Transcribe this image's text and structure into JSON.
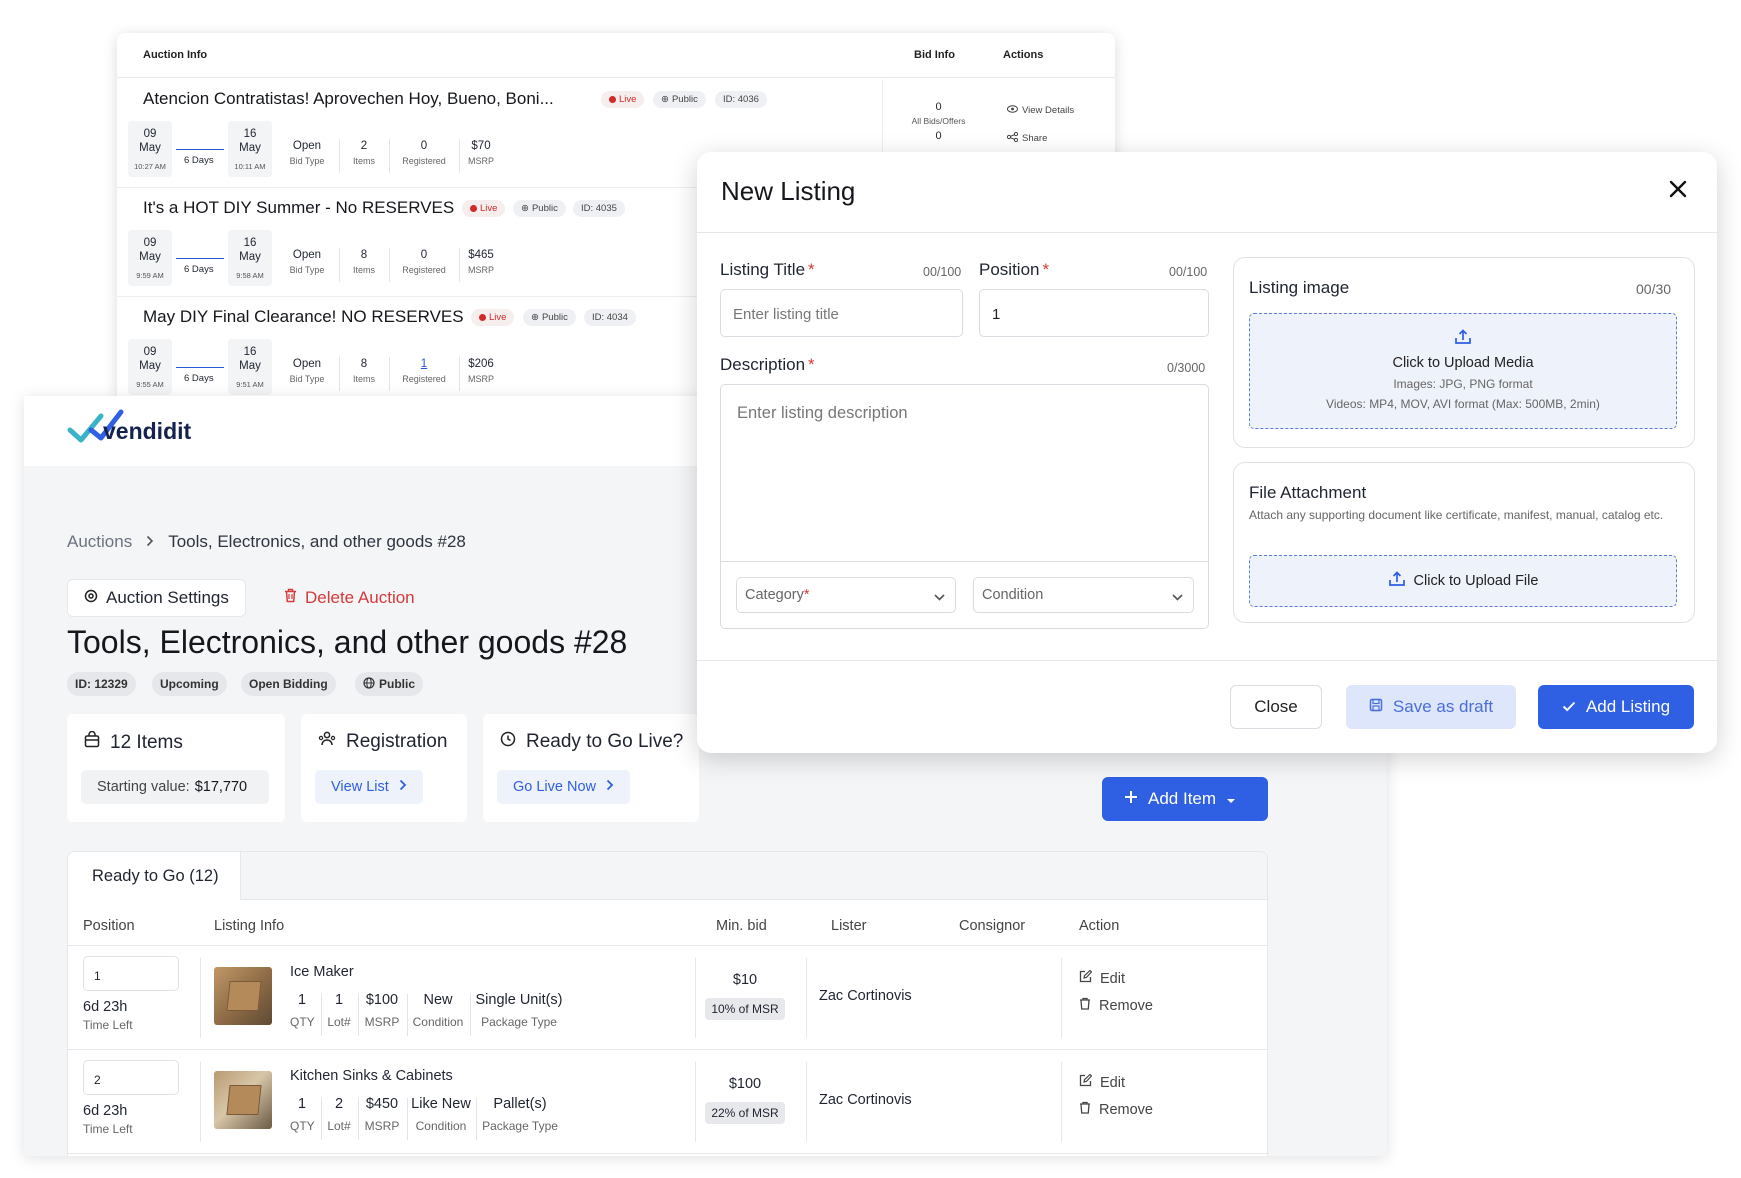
{
  "back_table": {
    "headers": {
      "auction_info": "Auction Info",
      "bid_info": "Bid Info",
      "actions": "Actions"
    },
    "rows": [
      {
        "title": "Atencion Contratistas! Aprovechen Hoy, Bueno, Boni...",
        "status": "Live",
        "visibility": "Public",
        "id": "ID: 4036",
        "start_day": "09",
        "start_month": "May",
        "start_time": "10:27 AM",
        "duration": "6 Days",
        "end_day": "16",
        "end_month": "May",
        "end_time": "10:11 AM",
        "bid_type": "Open",
        "bid_type_label": "Bid Type",
        "items": "2",
        "items_label": "Items",
        "registered": "0",
        "registered_label": "Registered",
        "msrp": "$70",
        "msrp_label": "MSRP",
        "bids_count": "0",
        "bids_label": "All Bids/Offers",
        "second_count": "0",
        "view_details": "View Details",
        "share": "Share"
      },
      {
        "title": "It's a HOT DIY Summer - No RESERVES",
        "status": "Live",
        "visibility": "Public",
        "id": "ID: 4035",
        "start_day": "09",
        "start_month": "May",
        "start_time": "9:59 AM",
        "duration": "6 Days",
        "end_day": "16",
        "end_month": "May",
        "end_time": "9:58 AM",
        "bid_type": "Open",
        "bid_type_label": "Bid Type",
        "items": "8",
        "items_label": "Items",
        "registered": "0",
        "registered_label": "Registered",
        "msrp": "$465",
        "msrp_label": "MSRP"
      },
      {
        "title": "May DIY Final Clearance! NO RESERVES",
        "status": "Live",
        "visibility": "Public",
        "id": "ID: 4034",
        "start_day": "09",
        "start_month": "May",
        "start_time": "9:55 AM",
        "duration": "6 Days",
        "end_day": "16",
        "end_month": "May",
        "end_time": "9:51 AM",
        "bid_type": "Open",
        "bid_type_label": "Bid Type",
        "items": "8",
        "items_label": "Items",
        "registered": "1",
        "registered_label": "Registered",
        "msrp": "$206",
        "msrp_label": "MSRP"
      }
    ]
  },
  "main": {
    "logo_text": "vendidit",
    "breadcrumb": {
      "root": "Auctions",
      "current": "Tools, Electronics, and other goods #28"
    },
    "auction_settings_label": "Auction Settings",
    "delete_auction_label": "Delete Auction",
    "page_title": "Tools, Electronics, and other goods #28",
    "tags": {
      "id": "ID: 12329",
      "status": "Upcoming",
      "bidding": "Open Bidding",
      "visibility": "Public"
    },
    "cards": {
      "items_title": "12 Items",
      "starting_label": "Starting value:",
      "starting_value": "$17,770",
      "registration_title": "Registration",
      "view_list": "View List",
      "golive_title": "Ready to Go Live?",
      "go_live_now": "Go Live Now"
    },
    "add_item_label": "Add Item",
    "tab_label": "Ready to Go (12)",
    "columns": {
      "position": "Position",
      "listing_info": "Listing Info",
      "min_bid": "Min. bid",
      "lister": "Lister",
      "consignor": "Consignor",
      "action": "Action"
    },
    "rows": [
      {
        "position": "1",
        "time_left": "6d 23h",
        "time_left_label": "Time Left",
        "name": "Ice Maker",
        "qty": "1",
        "qty_label": "QTY",
        "lot": "1",
        "lot_label": "Lot#",
        "msrp": "$100",
        "msrp_label": "MSRP",
        "condition": "New",
        "condition_label": "Condition",
        "package": "Single Unit(s)",
        "package_label": "Package Type",
        "min_bid": "$10",
        "pct": "10% of MSR",
        "lister": "Zac Cortinovis",
        "edit": "Edit",
        "remove": "Remove"
      },
      {
        "position": "2",
        "time_left": "6d 23h",
        "time_left_label": "Time Left",
        "name": "Kitchen Sinks & Cabinets",
        "qty": "1",
        "qty_label": "QTY",
        "lot": "2",
        "lot_label": "Lot#",
        "msrp": "$450",
        "msrp_label": "MSRP",
        "condition": "Like New",
        "condition_label": "Condition",
        "package": "Pallet(s)",
        "package_label": "Package Type",
        "min_bid": "$100",
        "pct": "22% of MSR",
        "lister": "Zac Cortinovis",
        "edit": "Edit",
        "remove": "Remove"
      }
    ]
  },
  "modal": {
    "title": "New Listing",
    "listing_title_label": "Listing Title",
    "listing_title_count": "00/100",
    "listing_title_placeholder": "Enter listing title",
    "position_label": "Position",
    "position_count": "00/100",
    "position_value": "1",
    "description_label": "Description",
    "description_count": "0/3000",
    "description_placeholder": "Enter listing description",
    "category_placeholder": "Category",
    "condition_placeholder": "Condition",
    "listing_image_label": "Listing image",
    "listing_image_count": "00/30",
    "upload_media": "Click to Upload Media",
    "upload_images_hint": "Images: JPG, PNG format",
    "upload_videos_hint": "Videos: MP4, MOV, AVI format (Max: 500MB, 2min)",
    "file_attachment_label": "File Attachment",
    "file_attachment_hint": "Attach any supporting document like certificate, manifest, manual, catalog etc.",
    "upload_file": "Click to Upload File",
    "close_label": "Close",
    "save_draft_label": "Save as draft",
    "add_listing_label": "Add Listing"
  },
  "colors": {
    "accent": "#2f5fe3",
    "danger": "#d53a3a",
    "live": "#d12a2a",
    "draft_bg": "#dde6fb"
  }
}
